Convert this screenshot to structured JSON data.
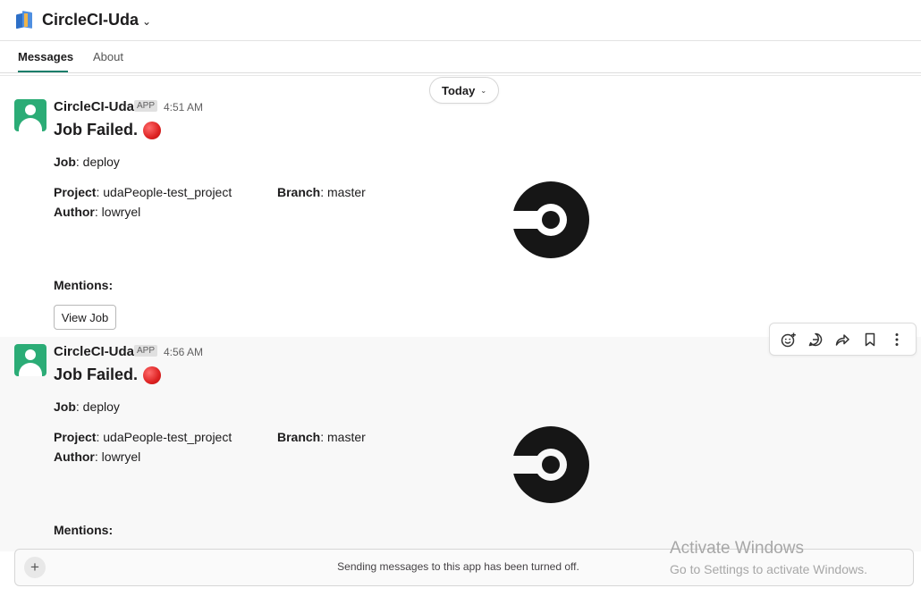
{
  "header": {
    "app_name": "CircleCI-Uda"
  },
  "tabs": [
    {
      "label": "Messages",
      "active": true
    },
    {
      "label": "About",
      "active": false
    }
  ],
  "date_divider": "Today",
  "messages": [
    {
      "sender": "CircleCI-Uda",
      "badge": "APP",
      "time": "4:51 AM",
      "headline": "Job Failed.",
      "job_label": "Job",
      "job": ": deploy",
      "project_label": "Project",
      "project": ": udaPeople-test_project",
      "branch_label": "Branch",
      "branch": ": master",
      "author_label": "Author",
      "author": ": lowryel",
      "mentions_label": "Mentions:",
      "button_label": "View Job"
    },
    {
      "sender": "CircleCI-Uda",
      "badge": "APP",
      "time": "4:56 AM",
      "headline": "Job Failed.",
      "job_label": "Job",
      "job": ": deploy",
      "project_label": "Project",
      "project": ": udaPeople-test_project",
      "branch_label": "Branch",
      "branch": ": master",
      "author_label": "Author",
      "author": ": lowryel",
      "mentions_label": "Mentions:"
    }
  ],
  "message_actions": [
    "add-reaction-icon",
    "reply-in-thread-icon",
    "forward-icon",
    "save-bookmark-icon",
    "more-actions-icon"
  ],
  "composer": {
    "note": "Sending messages to this app has been turned off."
  },
  "watermark": {
    "line1": "Activate Windows",
    "line2": "Go to Settings to activate Windows."
  },
  "colors": {
    "avatar": "#2bac76",
    "tab_underline": "#1a7e6a",
    "failed_dot": "#dd2222"
  }
}
